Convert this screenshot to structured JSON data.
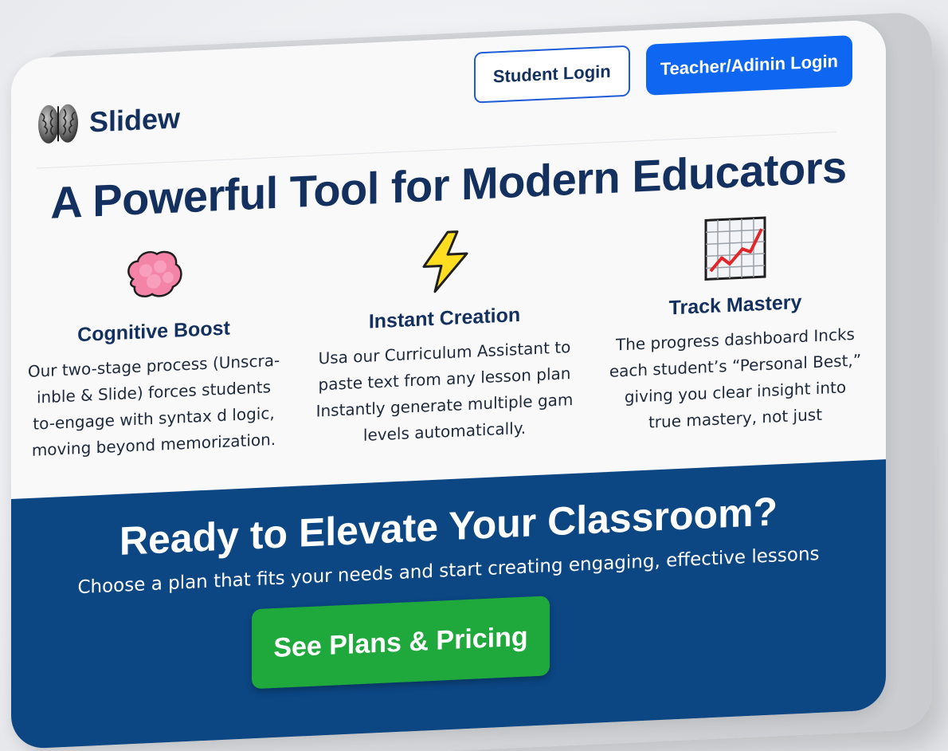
{
  "header": {
    "brand": "Slidew",
    "student_login": "Student Login",
    "teacher_login": "Teacher/Adinin Login"
  },
  "hero": {
    "headline": "A Powerful Tool for Modern Educators"
  },
  "features": [
    {
      "icon": "brain-icon",
      "title": "Cognitive Boost",
      "lines": [
        "Our two-stage process (Unscra-",
        "inble & Slide) forces students",
        "to-engage with syntax d logic,",
        "moving beyond memorization."
      ]
    },
    {
      "icon": "lightning-icon",
      "title": "Instant Creation",
      "lines": [
        "Usa our Curriculum Assistant to",
        "paste text from any lesson plan",
        "Instantly generate multiple gam",
        "levels automatically."
      ]
    },
    {
      "icon": "chart-icon",
      "title": "Track Mastery",
      "lines": [
        "The progress dashboard Incks",
        "each student’s “Personal Best,”",
        "giving you clear insight into",
        "true mastery, not just"
      ]
    }
  ],
  "cta": {
    "title": "Ready to Elevate Your Classroom?",
    "subtitle": "Choose a plan that fits your needs and start creating engaging, effective lessons",
    "button": "See Plans & Pricing"
  },
  "colors": {
    "navy": "#13305e",
    "primary_blue": "#0f66f0",
    "cta_band": "#0c4683",
    "cta_button": "#1fa83c"
  }
}
